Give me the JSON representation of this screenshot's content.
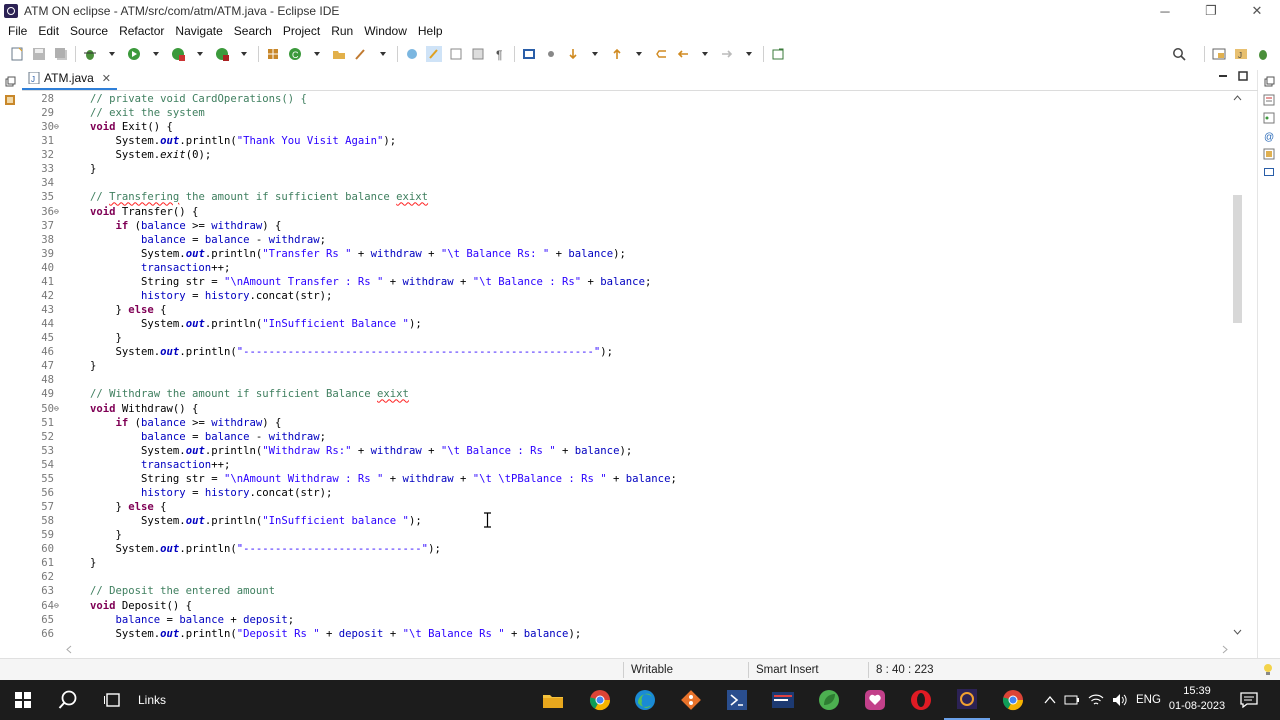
{
  "window": {
    "title": "ATM ON eclipse - ATM/src/com/atm/ATM.java - Eclipse IDE",
    "controls": {
      "minimize": "─",
      "restore": "❐",
      "close": "✕"
    }
  },
  "menu": [
    "File",
    "Edit",
    "Source",
    "Refactor",
    "Navigate",
    "Search",
    "Project",
    "Run",
    "Window",
    "Help"
  ],
  "editor": {
    "tab_label": "ATM.java",
    "tab_close": "✕",
    "lines": [
      {
        "n": "28",
        "fold": "",
        "indent": "",
        "tokens": [
          {
            "t": "cm",
            "v": "// private void CardOperations() {"
          }
        ]
      },
      {
        "n": "29",
        "fold": "",
        "indent": "",
        "tokens": [
          {
            "t": "cm",
            "v": "// exit the system"
          }
        ]
      },
      {
        "n": "30",
        "fold": "⊖",
        "indent": "",
        "tokens": [
          {
            "t": "kw",
            "v": "void"
          },
          {
            "t": "",
            "v": " Exit() {"
          }
        ]
      },
      {
        "n": "31",
        "fold": "",
        "indent": "    ",
        "tokens": [
          {
            "t": "",
            "v": "System."
          },
          {
            "t": "sf",
            "v": "out"
          },
          {
            "t": "",
            "v": ".println("
          },
          {
            "t": "st",
            "v": "\"Thank You Visit Again\""
          },
          {
            "t": "",
            "v": ");"
          }
        ]
      },
      {
        "n": "32",
        "fold": "",
        "indent": "    ",
        "tokens": [
          {
            "t": "",
            "v": "System."
          },
          {
            "t": "i",
            "v": "exit"
          },
          {
            "t": "",
            "v": "(0);"
          }
        ]
      },
      {
        "n": "33",
        "fold": "",
        "indent": "",
        "tokens": [
          {
            "t": "",
            "v": "}"
          }
        ]
      },
      {
        "n": "34",
        "fold": "",
        "indent": "",
        "tokens": []
      },
      {
        "n": "35",
        "fold": "",
        "indent": "",
        "tokens": [
          {
            "t": "cm",
            "v": "// "
          },
          {
            "t": "cmsq",
            "v": "Transfering"
          },
          {
            "t": "cm",
            "v": " the amount if sufficient balance "
          },
          {
            "t": "cmsq",
            "v": "exixt"
          }
        ]
      },
      {
        "n": "36",
        "fold": "⊖",
        "indent": "",
        "tokens": [
          {
            "t": "kw",
            "v": "void"
          },
          {
            "t": "",
            "v": " Transfer() {"
          }
        ]
      },
      {
        "n": "37",
        "fold": "",
        "indent": "    ",
        "tokens": [
          {
            "t": "kw",
            "v": "if"
          },
          {
            "t": "",
            "v": " ("
          },
          {
            "t": "fd",
            "v": "balance"
          },
          {
            "t": "",
            "v": " >= "
          },
          {
            "t": "fd",
            "v": "withdraw"
          },
          {
            "t": "",
            "v": ") {"
          }
        ]
      },
      {
        "n": "38",
        "fold": "",
        "indent": "        ",
        "tokens": [
          {
            "t": "fd",
            "v": "balance"
          },
          {
            "t": "",
            "v": " = "
          },
          {
            "t": "fd",
            "v": "balance"
          },
          {
            "t": "",
            "v": " - "
          },
          {
            "t": "fd",
            "v": "withdraw"
          },
          {
            "t": "",
            "v": ";"
          }
        ]
      },
      {
        "n": "39",
        "fold": "",
        "indent": "        ",
        "tokens": [
          {
            "t": "",
            "v": "System."
          },
          {
            "t": "sf",
            "v": "out"
          },
          {
            "t": "",
            "v": ".println("
          },
          {
            "t": "st",
            "v": "\"Transfer Rs \""
          },
          {
            "t": "",
            "v": " + "
          },
          {
            "t": "fd",
            "v": "withdraw"
          },
          {
            "t": "",
            "v": " + "
          },
          {
            "t": "st",
            "v": "\"\\t Balance Rs: \""
          },
          {
            "t": "",
            "v": " + "
          },
          {
            "t": "fd",
            "v": "balance"
          },
          {
            "t": "",
            "v": ");"
          }
        ]
      },
      {
        "n": "40",
        "fold": "",
        "indent": "        ",
        "tokens": [
          {
            "t": "fd",
            "v": "transaction"
          },
          {
            "t": "",
            "v": "++;"
          }
        ]
      },
      {
        "n": "41",
        "fold": "",
        "indent": "        ",
        "tokens": [
          {
            "t": "",
            "v": "String str = "
          },
          {
            "t": "st",
            "v": "\"\\nAmount Transfer : Rs \""
          },
          {
            "t": "",
            "v": " + "
          },
          {
            "t": "fd",
            "v": "withdraw"
          },
          {
            "t": "",
            "v": " + "
          },
          {
            "t": "st",
            "v": "\"\\t Balance : Rs\""
          },
          {
            "t": "",
            "v": " + "
          },
          {
            "t": "fd",
            "v": "balance"
          },
          {
            "t": "",
            "v": ";"
          }
        ]
      },
      {
        "n": "42",
        "fold": "",
        "indent": "        ",
        "tokens": [
          {
            "t": "fd",
            "v": "history"
          },
          {
            "t": "",
            "v": " = "
          },
          {
            "t": "fd",
            "v": "history"
          },
          {
            "t": "",
            "v": ".concat(str);"
          }
        ]
      },
      {
        "n": "43",
        "fold": "",
        "indent": "    ",
        "tokens": [
          {
            "t": "",
            "v": "} "
          },
          {
            "t": "kw",
            "v": "else"
          },
          {
            "t": "",
            "v": " {"
          }
        ]
      },
      {
        "n": "44",
        "fold": "",
        "indent": "        ",
        "tokens": [
          {
            "t": "",
            "v": "System."
          },
          {
            "t": "sf",
            "v": "out"
          },
          {
            "t": "",
            "v": ".println("
          },
          {
            "t": "st",
            "v": "\"InSufficient Balance \""
          },
          {
            "t": "",
            "v": ");"
          }
        ]
      },
      {
        "n": "45",
        "fold": "",
        "indent": "    ",
        "tokens": [
          {
            "t": "",
            "v": "}"
          }
        ]
      },
      {
        "n": "46",
        "fold": "",
        "indent": "    ",
        "tokens": [
          {
            "t": "",
            "v": "System."
          },
          {
            "t": "sf",
            "v": "out"
          },
          {
            "t": "",
            "v": ".println("
          },
          {
            "t": "st",
            "v": "\"-------------------------------------------------------\""
          },
          {
            "t": "",
            "v": ");"
          }
        ]
      },
      {
        "n": "47",
        "fold": "",
        "indent": "",
        "tokens": [
          {
            "t": "",
            "v": "}"
          }
        ]
      },
      {
        "n": "48",
        "fold": "",
        "indent": "",
        "tokens": []
      },
      {
        "n": "49",
        "fold": "",
        "indent": "",
        "tokens": [
          {
            "t": "cm",
            "v": "// Withdraw the amount if sufficient Balance "
          },
          {
            "t": "cmsq",
            "v": "exixt"
          }
        ]
      },
      {
        "n": "50",
        "fold": "⊖",
        "indent": "",
        "tokens": [
          {
            "t": "kw",
            "v": "void"
          },
          {
            "t": "",
            "v": " Withdraw() {"
          }
        ]
      },
      {
        "n": "51",
        "fold": "",
        "indent": "    ",
        "tokens": [
          {
            "t": "kw",
            "v": "if"
          },
          {
            "t": "",
            "v": " ("
          },
          {
            "t": "fd",
            "v": "balance"
          },
          {
            "t": "",
            "v": " >= "
          },
          {
            "t": "fd",
            "v": "withdraw"
          },
          {
            "t": "",
            "v": ") {"
          }
        ]
      },
      {
        "n": "52",
        "fold": "",
        "indent": "        ",
        "tokens": [
          {
            "t": "fd",
            "v": "balance"
          },
          {
            "t": "",
            "v": " = "
          },
          {
            "t": "fd",
            "v": "balance"
          },
          {
            "t": "",
            "v": " - "
          },
          {
            "t": "fd",
            "v": "withdraw"
          },
          {
            "t": "",
            "v": ";"
          }
        ]
      },
      {
        "n": "53",
        "fold": "",
        "indent": "        ",
        "tokens": [
          {
            "t": "",
            "v": "System."
          },
          {
            "t": "sf",
            "v": "out"
          },
          {
            "t": "",
            "v": ".println("
          },
          {
            "t": "st",
            "v": "\"Withdraw Rs:\""
          },
          {
            "t": "",
            "v": " + "
          },
          {
            "t": "fd",
            "v": "withdraw"
          },
          {
            "t": "",
            "v": " + "
          },
          {
            "t": "st",
            "v": "\"\\t Balance : Rs \""
          },
          {
            "t": "",
            "v": " + "
          },
          {
            "t": "fd",
            "v": "balance"
          },
          {
            "t": "",
            "v": ");"
          }
        ]
      },
      {
        "n": "54",
        "fold": "",
        "indent": "        ",
        "tokens": [
          {
            "t": "fd",
            "v": "transaction"
          },
          {
            "t": "",
            "v": "++;"
          }
        ]
      },
      {
        "n": "55",
        "fold": "",
        "indent": "        ",
        "tokens": [
          {
            "t": "",
            "v": "String str = "
          },
          {
            "t": "st",
            "v": "\"\\nAmount Withdraw : Rs \""
          },
          {
            "t": "",
            "v": " + "
          },
          {
            "t": "fd",
            "v": "withdraw"
          },
          {
            "t": "",
            "v": " + "
          },
          {
            "t": "st",
            "v": "\"\\t \\tPBalance : Rs \""
          },
          {
            "t": "",
            "v": " + "
          },
          {
            "t": "fd",
            "v": "balance"
          },
          {
            "t": "",
            "v": ";"
          }
        ]
      },
      {
        "n": "56",
        "fold": "",
        "indent": "        ",
        "tokens": [
          {
            "t": "fd",
            "v": "history"
          },
          {
            "t": "",
            "v": " = "
          },
          {
            "t": "fd",
            "v": "history"
          },
          {
            "t": "",
            "v": ".concat(str);"
          }
        ]
      },
      {
        "n": "57",
        "fold": "",
        "indent": "    ",
        "tokens": [
          {
            "t": "",
            "v": "} "
          },
          {
            "t": "kw",
            "v": "else"
          },
          {
            "t": "",
            "v": " {"
          }
        ]
      },
      {
        "n": "58",
        "fold": "",
        "indent": "        ",
        "tokens": [
          {
            "t": "",
            "v": "System."
          },
          {
            "t": "sf",
            "v": "out"
          },
          {
            "t": "",
            "v": ".println("
          },
          {
            "t": "st",
            "v": "\"InSufficient balance \""
          },
          {
            "t": "",
            "v": ");"
          }
        ]
      },
      {
        "n": "59",
        "fold": "",
        "indent": "    ",
        "tokens": [
          {
            "t": "",
            "v": "}"
          }
        ]
      },
      {
        "n": "60",
        "fold": "",
        "indent": "    ",
        "tokens": [
          {
            "t": "",
            "v": "System."
          },
          {
            "t": "sf",
            "v": "out"
          },
          {
            "t": "",
            "v": ".println("
          },
          {
            "t": "st",
            "v": "\"----------------------------\""
          },
          {
            "t": "",
            "v": ");"
          }
        ]
      },
      {
        "n": "61",
        "fold": "",
        "indent": "",
        "tokens": [
          {
            "t": "",
            "v": "}"
          }
        ]
      },
      {
        "n": "62",
        "fold": "",
        "indent": "",
        "tokens": []
      },
      {
        "n": "63",
        "fold": "",
        "indent": "",
        "tokens": [
          {
            "t": "cm",
            "v": "// Deposit the entered amount"
          }
        ]
      },
      {
        "n": "64",
        "fold": "⊖",
        "indent": "",
        "tokens": [
          {
            "t": "kw",
            "v": "void"
          },
          {
            "t": "",
            "v": " Deposit() {"
          }
        ]
      },
      {
        "n": "65",
        "fold": "",
        "indent": "    ",
        "tokens": [
          {
            "t": "fd",
            "v": "balance"
          },
          {
            "t": "",
            "v": " = "
          },
          {
            "t": "fd",
            "v": "balance"
          },
          {
            "t": "",
            "v": " + "
          },
          {
            "t": "fd",
            "v": "deposit"
          },
          {
            "t": "",
            "v": ";"
          }
        ]
      },
      {
        "n": "66",
        "fold": "",
        "indent": "    ",
        "tokens": [
          {
            "t": "",
            "v": "System."
          },
          {
            "t": "sf",
            "v": "out"
          },
          {
            "t": "",
            "v": ".println("
          },
          {
            "t": "st",
            "v": "\"Deposit Rs \""
          },
          {
            "t": "",
            "v": " + "
          },
          {
            "t": "fd",
            "v": "deposit"
          },
          {
            "t": "",
            "v": " + "
          },
          {
            "t": "st",
            "v": "\"\\t Balance Rs \""
          },
          {
            "t": "",
            "v": " + "
          },
          {
            "t": "fd",
            "v": "balance"
          },
          {
            "t": "",
            "v": ");"
          }
        ]
      }
    ]
  },
  "status": {
    "mode": "Writable",
    "insert": "Smart Insert",
    "position": "8 : 40 : 223"
  },
  "taskbar": {
    "links_label": "Links",
    "language": "ENG",
    "time": "15:39",
    "date": "01-08-2023"
  },
  "colors": {
    "keyword": "#7f0055",
    "comment": "#3f7f5f",
    "string": "#2a00ff",
    "field": "#0000c0",
    "taskbar": "#1c1c1c"
  }
}
